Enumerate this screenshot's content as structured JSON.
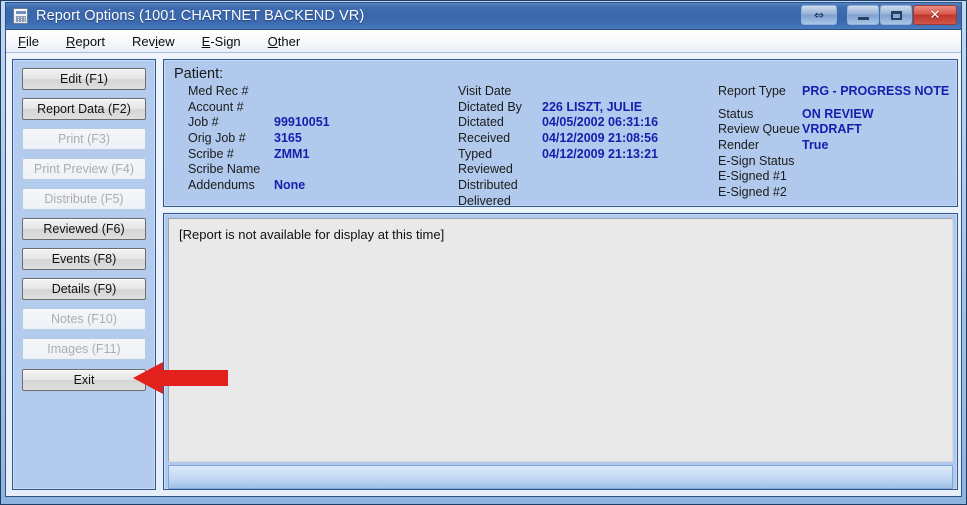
{
  "window": {
    "title": "Report Options  (1001 CHARTNET BACKEND VR)",
    "icon": "report-document-icon",
    "titlebar_color": "#3a66ac",
    "buttons": {
      "restore_label": "⇔",
      "minimize_label": "minimize-glyph",
      "maximize_label": "maximize-glyph",
      "close_label": "✕"
    }
  },
  "menubar": {
    "items": [
      {
        "label": "File",
        "accel_index": 0
      },
      {
        "label": "Report",
        "accel_index": 0
      },
      {
        "label": "Review",
        "accel_index": 3
      },
      {
        "label": "E-Sign",
        "accel_index": 0
      },
      {
        "label": "Other",
        "accel_index": 0
      }
    ]
  },
  "sidebar": {
    "buttons": [
      {
        "label": "Edit (F1)",
        "enabled": true
      },
      {
        "label": "Report Data (F2)",
        "enabled": true
      },
      {
        "label": "Print (F3)",
        "enabled": false
      },
      {
        "label": "Print Preview (F4)",
        "enabled": false
      },
      {
        "label": "Distribute (F5)",
        "enabled": false
      },
      {
        "label": "Reviewed (F6)",
        "enabled": true
      },
      {
        "label": "Events (F8)",
        "enabled": true
      },
      {
        "label": "Details (F9)",
        "enabled": true
      },
      {
        "label": "Notes (F10)",
        "enabled": false
      },
      {
        "label": "Images (F11)",
        "enabled": false
      },
      {
        "label": "Exit",
        "enabled": true
      }
    ]
  },
  "patient_panel": {
    "title": "Patient:",
    "panel_color": "#b0c9ec",
    "value_color": "#151fae",
    "column_a": [
      {
        "label": "Med Rec #",
        "value": ""
      },
      {
        "label": "Account #",
        "value": ""
      },
      {
        "label": "Job #",
        "value": "99910051"
      },
      {
        "label": "Orig Job #",
        "value": "3165"
      },
      {
        "label": "Scribe #",
        "value": "ZMM1"
      },
      {
        "label": "Scribe Name",
        "value": ""
      },
      {
        "label": "Addendums",
        "value": "None"
      }
    ],
    "column_b": [
      {
        "label": "Visit Date",
        "value": ""
      },
      {
        "label": "Dictated By",
        "value": "226 LISZT, JULIE"
      },
      {
        "label": "Dictated",
        "value": "04/05/2002  06:31:16"
      },
      {
        "label": "Received",
        "value": "04/12/2009  21:08:56"
      },
      {
        "label": "Typed",
        "value": "04/12/2009  21:13:21"
      },
      {
        "label": "Reviewed",
        "value": ""
      },
      {
        "label": "Distributed",
        "value": ""
      },
      {
        "label": "Delivered",
        "value": ""
      }
    ],
    "column_c_top": {
      "label": "Report Type",
      "value": "PRG - PROGRESS NOTE"
    },
    "column_c": [
      {
        "label": "Status",
        "value": "ON REVIEW"
      },
      {
        "label": "Review Queue",
        "value": "VRDRAFT"
      },
      {
        "label": "Render",
        "value": "True"
      },
      {
        "label": "E-Sign Status",
        "value": ""
      },
      {
        "label": "E-Signed #1",
        "value": ""
      },
      {
        "label": "E-Signed #2",
        "value": ""
      }
    ]
  },
  "report_view": {
    "text": "[Report is not available for display at this time]"
  },
  "annotation": {
    "arrow_color": "#e2211c",
    "points_to": "Exit"
  }
}
